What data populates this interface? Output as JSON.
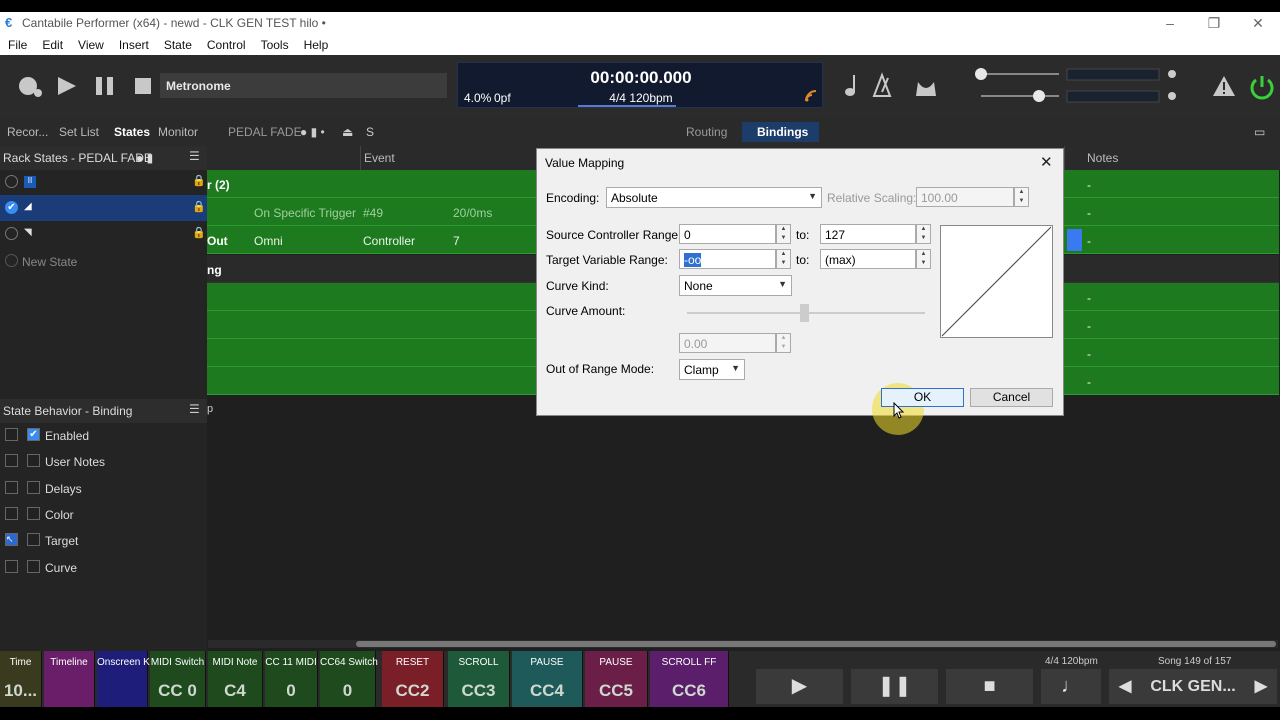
{
  "window": {
    "title": "Cantabile Performer (x64) - newd - CLK GEN TEST hilo •",
    "minimize": "–",
    "restore": "❐",
    "close": "✕"
  },
  "menu": [
    "File",
    "Edit",
    "View",
    "Insert",
    "State",
    "Control",
    "Tools",
    "Help"
  ],
  "toolbar": {
    "metronome_label": "Metronome",
    "time": "00:00:00.000",
    "load": "4.0%",
    "pf": "0pf",
    "tempo": "4/4 120bpm"
  },
  "nav": {
    "tabs": [
      "Recor...",
      "Set List",
      "States",
      "Monitor"
    ],
    "active": "States",
    "song_name": "PEDAL FADE",
    "state_letter": "S",
    "routing": "Routing",
    "bindings": "Bindings"
  },
  "left": {
    "rack_states_title": "Rack States - PEDAL FADE",
    "new_state": "New State",
    "behavior_title": "State Behavior - Binding",
    "behaviors": [
      {
        "label": "Enabled",
        "checked": true
      },
      {
        "label": "User Notes",
        "checked": false
      },
      {
        "label": "Delays",
        "checked": false
      },
      {
        "label": "Color",
        "checked": false
      },
      {
        "label": "Target",
        "checked": false
      },
      {
        "label": "Curve",
        "checked": false
      }
    ]
  },
  "table": {
    "headers": {
      "event": "Event",
      "notes": "Notes"
    },
    "rows": [
      {
        "c0": "r (2)",
        "c1": "",
        "c2": "",
        "c3": "",
        "n": "-"
      },
      {
        "c0": "",
        "c1": "On Specific Trigger",
        "c2": "#49",
        "c3": "20/0ms",
        "n": "-"
      },
      {
        "c0": "Out",
        "c1": "Omni",
        "c2": "Controller",
        "c3": "7",
        "n": "-"
      },
      {
        "c0": "ng",
        "c1": "",
        "c2": "",
        "c3": "",
        "n": ""
      },
      {
        "c0": "",
        "c1": "",
        "c2": "",
        "c3": "",
        "n": "-"
      },
      {
        "c0": "",
        "c1": "",
        "c2": "",
        "c3": "",
        "n": "-"
      },
      {
        "c0": "",
        "c1": "",
        "c2": "",
        "c3": "",
        "n": "-"
      },
      {
        "c0": "",
        "c1": "",
        "c2": "",
        "c3": "",
        "n": "-"
      }
    ],
    "trailing": "p"
  },
  "dialog": {
    "title": "Value Mapping",
    "encoding_label": "Encoding:",
    "encoding_value": "Absolute",
    "relative_label": "Relative Scaling:",
    "relative_value": "100.00",
    "source_label": "Source Controller Range:",
    "source_from": "0",
    "source_to": "127",
    "to_label": "to:",
    "target_label": "Target Variable Range:",
    "target_from": "-oo",
    "target_to": "(max)",
    "curve_kind_label": "Curve Kind:",
    "curve_kind_value": "None",
    "curve_amount_label": "Curve Amount:",
    "curve_amount_value": "0.00",
    "oor_label": "Out of Range Mode:",
    "oor_value": "Clamp",
    "ok": "OK",
    "cancel": "Cancel"
  },
  "bottom": [
    {
      "top": "Time",
      "big": "10...",
      "bg": "#3a3a1e"
    },
    {
      "top": "Timeline",
      "big": "",
      "bg": "#6a1e6a"
    },
    {
      "top": "Onscreen Keys",
      "big": "",
      "bg": "#1e1e7a"
    },
    {
      "top": "MIDI Switch",
      "big": "CC 0",
      "bg": "#1e4a1e"
    },
    {
      "top": "MIDI Note",
      "big": "C4",
      "bg": "#1e4a1e"
    },
    {
      "top": "CC 11 MIDI",
      "big": "0",
      "bg": "#1e4a1e"
    },
    {
      "top": "CC64 Switch",
      "big": "0",
      "bg": "#1e4a1e"
    },
    {
      "top": "RESET",
      "big": "CC2",
      "bg": "#7a1e28"
    },
    {
      "top": "SCROLL",
      "big": "CC3",
      "bg": "#1e5a3a"
    },
    {
      "top": "PAUSE",
      "big": "CC4",
      "bg": "#1e5a5a"
    },
    {
      "top": "PAUSE",
      "big": "CC5",
      "bg": "#6a1e48"
    },
    {
      "top": "SCROLL FF",
      "big": "CC6",
      "bg": "#5a1e6a"
    }
  ],
  "status": {
    "tempo": "4/4 120bpm",
    "song_pos": "Song 149 of 157",
    "song_name": "CLK GEN..."
  }
}
